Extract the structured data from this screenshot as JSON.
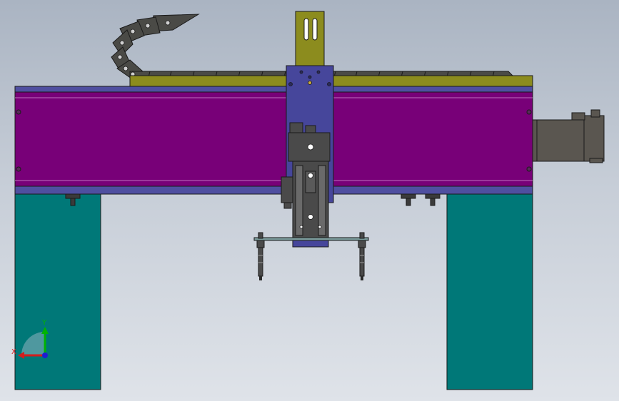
{
  "viewport": {
    "background_top": "#aab4c2",
    "background_bottom": "#dfe3e9"
  },
  "colors": {
    "beam": "#780078",
    "beam_trim": "#4f4fa0",
    "legs": "#007878",
    "rail": "#8c8c1e",
    "carriage": "#46469b",
    "mount_plate": "#8c8c1e",
    "motor": "#5a5650",
    "cylinder": "#4a4a4a",
    "cable_chain": "#4a4a46",
    "edge": "#1a1a1a"
  },
  "triad": {
    "y_label": "Y",
    "x_label": "X",
    "y_color": "#00b400",
    "x_color": "#d21e1e"
  }
}
